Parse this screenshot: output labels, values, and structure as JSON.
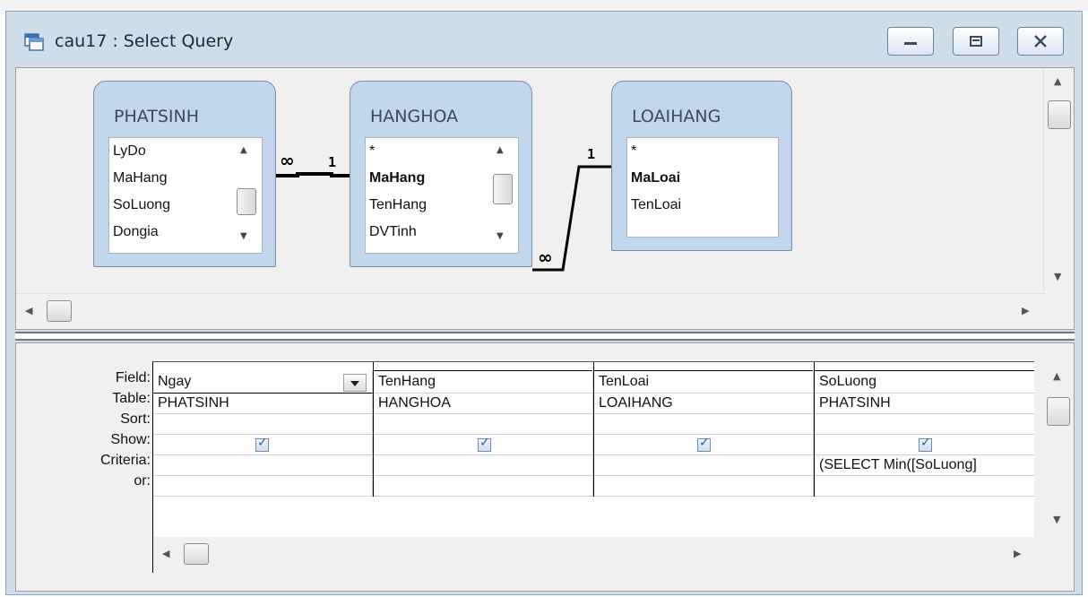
{
  "window": {
    "title": "cau17 : Select Query",
    "buttons": [
      "minimize-icon",
      "restore-icon",
      "close-icon"
    ],
    "colors": {
      "frame": "#cfdcea",
      "table_box": "#c2d7ec",
      "checkbox": "#2d5fa4"
    }
  },
  "tables": [
    {
      "name": "PHATSINH",
      "fields": [
        "LyDo",
        "MaHang",
        "SoLuong",
        "Dongia"
      ],
      "bold_fields": []
    },
    {
      "name": "HANGHOA",
      "fields": [
        "*",
        "MaHang",
        "TenHang",
        "DVTinh"
      ],
      "bold_fields": [
        "MaHang"
      ]
    },
    {
      "name": "LOAIHANG",
      "fields": [
        "*",
        "MaLoai",
        "TenLoai"
      ],
      "bold_fields": [
        "MaLoai"
      ]
    }
  ],
  "joins": [
    {
      "from": "PHATSINH",
      "to": "HANGHOA",
      "from_label": "∞",
      "to_label": "1"
    },
    {
      "from": "HANGHOA",
      "to": "LOAIHANG",
      "from_label": "∞",
      "to_label": "1"
    }
  ],
  "grid": {
    "row_labels": [
      "Field:",
      "Table:",
      "Sort:",
      "Show:",
      "Criteria:",
      "or:"
    ],
    "columns": [
      {
        "field": "Ngay",
        "table": "PHATSINH",
        "sort": "",
        "show": true,
        "criteria": "",
        "or": ""
      },
      {
        "field": "TenHang",
        "table": "HANGHOA",
        "sort": "",
        "show": true,
        "criteria": "",
        "or": ""
      },
      {
        "field": "TenLoai",
        "table": "LOAIHANG",
        "sort": "",
        "show": true,
        "criteria": "",
        "or": ""
      },
      {
        "field": "SoLuong",
        "table": "PHATSINH",
        "sort": "",
        "show": true,
        "criteria": "(SELECT Min([SoLuong]",
        "or": ""
      }
    ]
  }
}
